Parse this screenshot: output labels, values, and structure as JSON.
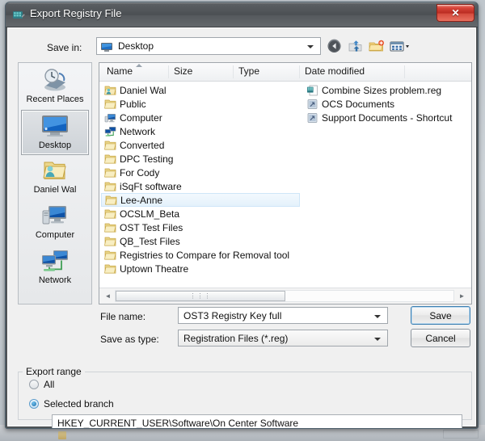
{
  "window": {
    "title": "Export Registry File",
    "icon": "registry-editor-icon",
    "close_label": "✕"
  },
  "toolbar": {
    "save_in_label": "Save in:",
    "save_in_value": "Desktop",
    "save_in_icon": "desktop-monitor-icon",
    "buttons": [
      {
        "name": "back-button",
        "icon": "back-arrow-icon"
      },
      {
        "name": "up-one-level-button",
        "icon": "up-folder-icon"
      },
      {
        "name": "new-folder-button",
        "icon": "new-folder-icon"
      },
      {
        "name": "views-button",
        "icon": "views-grid-icon"
      }
    ]
  },
  "places": {
    "items": [
      {
        "label": "Recent Places",
        "icon": "recent-places-icon",
        "selected": false
      },
      {
        "label": "Desktop",
        "icon": "desktop-icon",
        "selected": true
      },
      {
        "label": "Daniel Wal",
        "icon": "user-folder-icon",
        "selected": false
      },
      {
        "label": "Computer",
        "icon": "computer-icon",
        "selected": false
      },
      {
        "label": "Network",
        "icon": "network-icon",
        "selected": false
      }
    ]
  },
  "filelist": {
    "columns": [
      {
        "label": "Name",
        "sorted": "asc"
      },
      {
        "label": "Size",
        "sorted": ""
      },
      {
        "label": "Type",
        "sorted": ""
      },
      {
        "label": "Date modified",
        "sorted": ""
      }
    ],
    "column1": [
      {
        "label": "Daniel Wal",
        "icon": "user-folder-icon",
        "hover": false
      },
      {
        "label": "Public",
        "icon": "folder-icon",
        "hover": false
      },
      {
        "label": "Computer",
        "icon": "computer-icon",
        "hover": false
      },
      {
        "label": "Network",
        "icon": "network-icon",
        "hover": false
      },
      {
        "label": "Converted",
        "icon": "folder-icon",
        "hover": false
      },
      {
        "label": "DPC Testing",
        "icon": "folder-icon",
        "hover": false
      },
      {
        "label": "For Cody",
        "icon": "folder-icon",
        "hover": false
      },
      {
        "label": "iSqFt software",
        "icon": "folder-icon",
        "hover": false
      },
      {
        "label": "Lee-Anne",
        "icon": "folder-icon",
        "hover": true
      },
      {
        "label": "OCSLM_Beta",
        "icon": "folder-icon",
        "hover": false
      },
      {
        "label": "OST Test Files",
        "icon": "folder-icon",
        "hover": false
      },
      {
        "label": "QB_Test Files",
        "icon": "folder-icon",
        "hover": false
      },
      {
        "label": "Registries to Compare for Removal tool",
        "icon": "folder-icon",
        "hover": false
      },
      {
        "label": "Uptown Theatre",
        "icon": "folder-icon",
        "hover": false
      }
    ],
    "column2": [
      {
        "label": "Combine Sizes problem.reg",
        "icon": "registry-file-icon"
      },
      {
        "label": "OCS Documents",
        "icon": "shortcut-icon"
      },
      {
        "label": "Support Documents - Shortcut",
        "icon": "shortcut-icon"
      }
    ],
    "scrollbar": {
      "left_arrow": "◄",
      "right_arrow": "►",
      "grip": "⋮⋮⋮"
    }
  },
  "fields": {
    "file_name_label": "File name:",
    "file_name_value": "OST3 Registry Key full",
    "save_as_type_label": "Save as type:",
    "save_as_type_value": "Registration Files (*.reg)"
  },
  "actions": {
    "save_label": "Save",
    "cancel_label": "Cancel"
  },
  "export_range": {
    "group_label": "Export range",
    "options": [
      {
        "label": "All",
        "checked": false
      },
      {
        "label": "Selected branch",
        "checked": true
      }
    ],
    "branch_value": "HKEY_CURRENT_USER\\Software\\On Center Software"
  },
  "colors": {
    "accent": "#3c7fb1",
    "close_red": "#b82a20",
    "folder_yellow": "#ead18a",
    "hover_blue": "#e4f1fb"
  }
}
